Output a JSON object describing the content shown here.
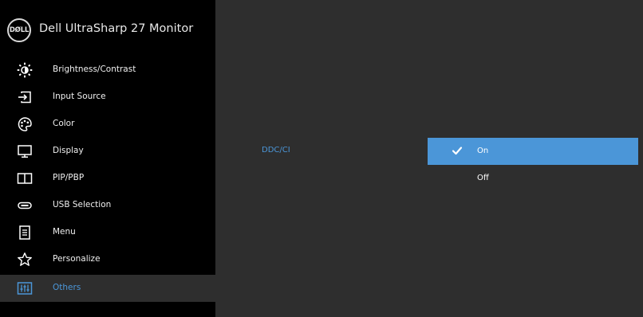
{
  "header": {
    "logo_text": "DØLL",
    "title": "Dell UltraSharp 27 Monitor"
  },
  "sidebar": {
    "items": [
      {
        "label": "Brightness/Contrast",
        "icon": "brightness-icon"
      },
      {
        "label": "Input Source",
        "icon": "input-source-icon"
      },
      {
        "label": "Color",
        "icon": "palette-icon"
      },
      {
        "label": "Display",
        "icon": "monitor-icon"
      },
      {
        "label": "PIP/PBP",
        "icon": "split-screen-icon"
      },
      {
        "label": "USB Selection",
        "icon": "usb-icon"
      },
      {
        "label": "Menu",
        "icon": "menu-list-icon"
      },
      {
        "label": "Personalize",
        "icon": "star-icon"
      },
      {
        "label": "Others",
        "icon": "sliders-icon",
        "active": true
      }
    ]
  },
  "main": {
    "setting_label": "DDC/CI",
    "options": [
      {
        "label": "On",
        "selected": true
      },
      {
        "label": "Off",
        "selected": false
      }
    ]
  },
  "colors": {
    "accent": "#4b96d8",
    "sidebar_bg": "#000000",
    "panel_bg": "#2e2e2e"
  }
}
